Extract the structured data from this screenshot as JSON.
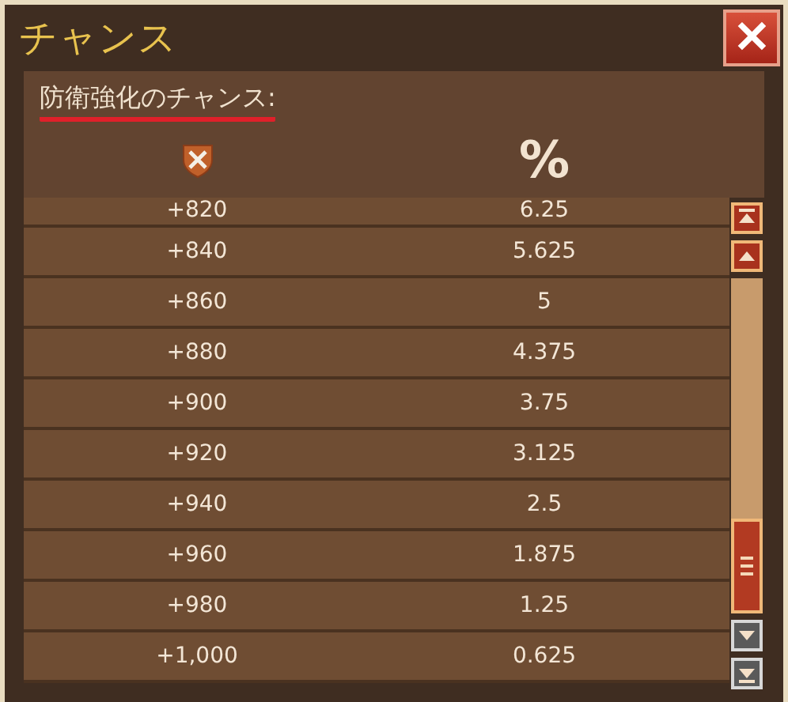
{
  "window": {
    "title": "チャンス",
    "close": "✕"
  },
  "section": {
    "heading": "防衛強化のチャンス:"
  },
  "table": {
    "columns": [
      {
        "kind": "icon"
      },
      {
        "kind": "text",
        "label": "%"
      }
    ],
    "rows": [
      {
        "bonus": "+820",
        "chance": "6.25",
        "clipped": true
      },
      {
        "bonus": "+840",
        "chance": "5.625",
        "clipped": false
      },
      {
        "bonus": "+860",
        "chance": "5",
        "clipped": false
      },
      {
        "bonus": "+880",
        "chance": "4.375",
        "clipped": false
      },
      {
        "bonus": "+900",
        "chance": "3.75",
        "clipped": false
      },
      {
        "bonus": "+920",
        "chance": "3.125",
        "clipped": false
      },
      {
        "bonus": "+940",
        "chance": "2.5",
        "clipped": false
      },
      {
        "bonus": "+960",
        "chance": "1.875",
        "clipped": false
      },
      {
        "bonus": "+980",
        "chance": "1.25",
        "clipped": false
      },
      {
        "bonus": "+1,000",
        "chance": "0.625",
        "clipped": false
      }
    ]
  }
}
